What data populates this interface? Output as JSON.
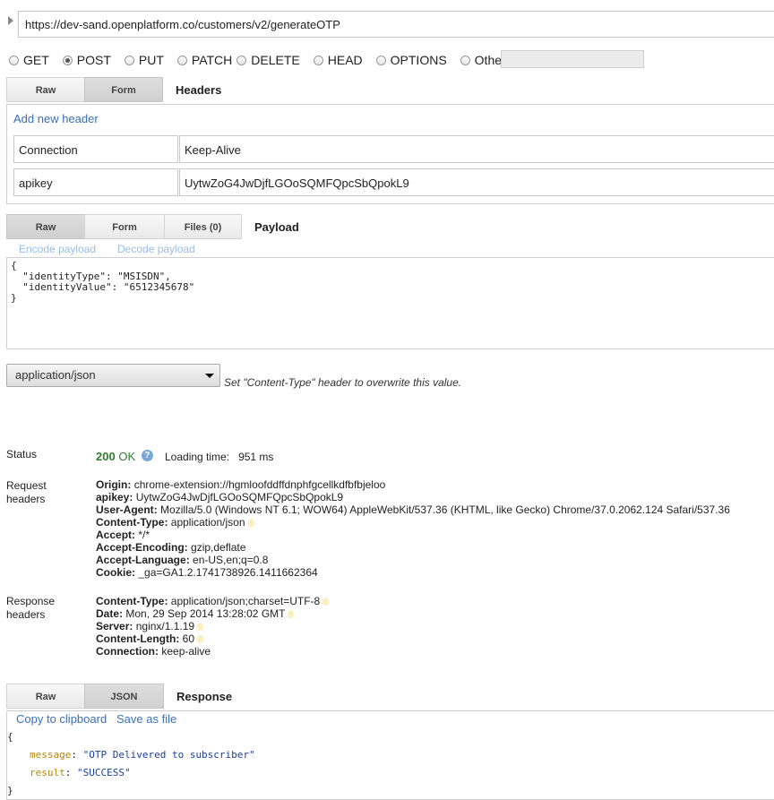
{
  "request": {
    "url": "https://dev-sand.openplatform.co/customers/v2/generateOTP",
    "methods": [
      {
        "label": "GET",
        "checked": false
      },
      {
        "label": "POST",
        "checked": true
      },
      {
        "label": "PUT",
        "checked": false
      },
      {
        "label": "PATCH",
        "checked": false
      },
      {
        "label": "DELETE",
        "checked": false
      },
      {
        "label": "HEAD",
        "checked": false
      },
      {
        "label": "OPTIONS",
        "checked": false
      },
      {
        "label": "Other",
        "checked": false
      }
    ]
  },
  "headers_section": {
    "tabs": [
      "Raw",
      "Form"
    ],
    "active_tab": "Form",
    "title": "Headers",
    "add_link": "Add new header",
    "rows": [
      {
        "name": "Connection",
        "value": "Keep-Alive"
      },
      {
        "name": "apikey",
        "value": "UytwZoG4JwDjfLGOoSQMFQpcSbQpokL9"
      }
    ]
  },
  "payload_section": {
    "tabs": [
      "Raw",
      "Form",
      "Files (0)"
    ],
    "active_tab": "Raw",
    "title": "Payload",
    "encode_link": "Encode payload",
    "decode_link": "Decode payload",
    "body": "{\n  \"identityType\": \"MSISDN\",\n  \"identityValue\": \"6512345678\"\n}"
  },
  "content_type": {
    "selected": "application/json",
    "hint": "Set \"Content-Type\" header to overwrite this value."
  },
  "status": {
    "label": "Status",
    "code": "200",
    "text": "OK",
    "help_icon": "question-circle-icon",
    "loading_label": "Loading time:",
    "loading_value": "951 ms"
  },
  "request_headers": {
    "label_line1": "Request",
    "label_line2": "headers",
    "items": [
      {
        "name": "Origin",
        "value": "chrome-extension://hgmloofddffdnphfgcellkdfbfbjeloo",
        "bulb": false
      },
      {
        "name": "apikey",
        "value": "UytwZoG4JwDjfLGOoSQMFQpcSbQpokL9",
        "bulb": false
      },
      {
        "name": "User-Agent",
        "value": "Mozilla/5.0 (Windows NT 6.1; WOW64) AppleWebKit/537.36 (KHTML, like Gecko) Chrome/37.0.2062.124 Safari/537.36",
        "bulb": false
      },
      {
        "name": "Content-Type",
        "value": "application/json",
        "bulb": true
      },
      {
        "name": "Accept",
        "value": "*/*",
        "bulb": false
      },
      {
        "name": "Accept-Encoding",
        "value": "gzip,deflate",
        "bulb": false
      },
      {
        "name": "Accept-Language",
        "value": "en-US,en;q=0.8",
        "bulb": false
      },
      {
        "name": "Cookie",
        "value": "_ga=GA1.2.1741738926.1411662364",
        "bulb": false
      }
    ]
  },
  "response_headers": {
    "label_line1": "Response",
    "label_line2": "headers",
    "items": [
      {
        "name": "Content-Type",
        "value": "application/json;charset=UTF-8",
        "bulb": true
      },
      {
        "name": "Date",
        "value": "Mon, 29 Sep 2014 13:28:02 GMT",
        "bulb": true
      },
      {
        "name": "Server",
        "value": "nginx/1.1.19",
        "bulb": true
      },
      {
        "name": "Content-Length",
        "value": "60",
        "bulb": true
      },
      {
        "name": "Connection",
        "value": "keep-alive",
        "bulb": false
      }
    ]
  },
  "response_section": {
    "tabs": [
      "Raw",
      "JSON"
    ],
    "active_tab": "JSON",
    "title": "Response",
    "copy_link": "Copy to clipboard",
    "save_link": "Save as file",
    "json": {
      "open": "{",
      "close": "}",
      "pairs": [
        {
          "key": "message",
          "value": "\"OTP Delivered to subscriber\""
        },
        {
          "key": "result",
          "value": "\"SUCCESS\""
        }
      ]
    }
  }
}
